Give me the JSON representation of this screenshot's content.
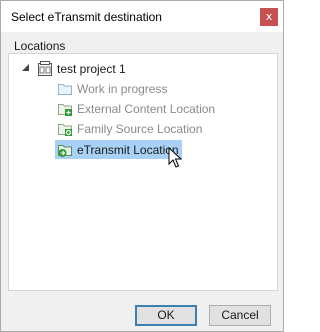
{
  "dialog": {
    "title": "Select eTransmit destination",
    "close_glyph": "x"
  },
  "group": {
    "label": "Locations"
  },
  "tree": {
    "root": {
      "label": "test project 1",
      "icon": "project-icon",
      "expanded": true
    },
    "children": [
      {
        "label": "Work in progress",
        "icon": "folder-icon",
        "disabled": true
      },
      {
        "label": "External Content Location",
        "icon": "external-content-folder-icon",
        "disabled": true
      },
      {
        "label": "Family Source Location",
        "icon": "family-source-folder-icon",
        "disabled": true
      },
      {
        "label": "eTransmit Location",
        "icon": "etransmit-folder-icon",
        "disabled": false,
        "selected": true
      }
    ]
  },
  "buttons": {
    "ok": "OK",
    "cancel": "Cancel"
  },
  "colors": {
    "selection": "#a8d2f5",
    "close_button": "#c75050",
    "folder_green_badge": "#2e9a3a"
  }
}
